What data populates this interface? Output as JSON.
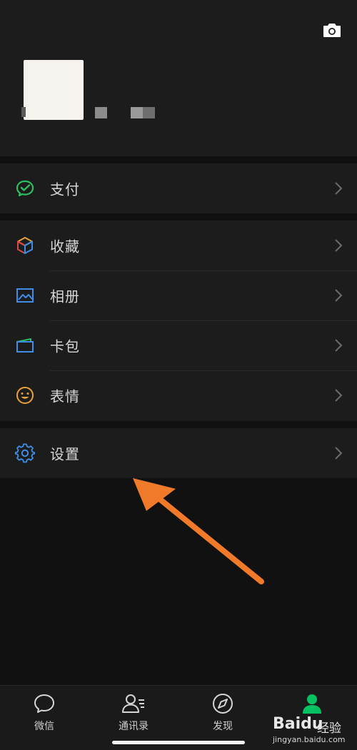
{
  "colors": {
    "background": "#111111",
    "panel": "#1c1c1c",
    "pay_green": "#2dbe60",
    "accent_blue": "#3e8ee8",
    "emoji_orange": "#e8a23a",
    "annotation_arrow": "#f07a2a",
    "active_tab_green": "#07c160"
  },
  "header": {
    "camera_icon": "camera-icon"
  },
  "menu": {
    "pay": {
      "label": "支付",
      "icon": "pay-icon"
    },
    "group2": [
      {
        "label": "收藏",
        "icon": "favorites-cube-icon"
      },
      {
        "label": "相册",
        "icon": "album-icon"
      },
      {
        "label": "卡包",
        "icon": "card-wallet-icon"
      },
      {
        "label": "表情",
        "icon": "sticker-face-icon"
      }
    ],
    "settings": {
      "label": "设置",
      "icon": "gear-icon"
    }
  },
  "tabbar": {
    "tabs": [
      {
        "label": "微信",
        "icon": "chat-bubble-icon"
      },
      {
        "label": "通讯录",
        "icon": "contacts-icon"
      },
      {
        "label": "发现",
        "icon": "compass-icon"
      },
      {
        "label": "",
        "icon": "me-icon",
        "active": true
      }
    ]
  },
  "watermark": {
    "brand": "Baidu",
    "text": "经验",
    "url": "jingyan.baidu.com"
  }
}
